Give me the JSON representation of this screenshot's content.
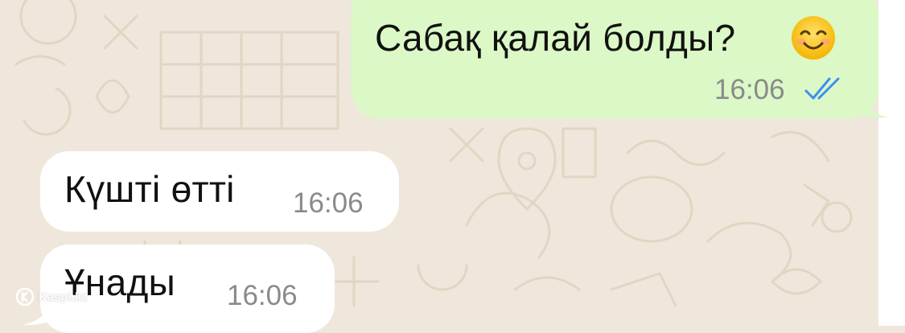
{
  "messages": [
    {
      "direction": "outgoing",
      "text": "Сабақ қалай болды?",
      "emoji": "smiling-face-emoji",
      "time": "16:06",
      "status": "read"
    },
    {
      "direction": "incoming",
      "text": "Күшті өтті",
      "time": "16:06"
    },
    {
      "direction": "incoming",
      "text": "Ұнады",
      "time": "16:06"
    }
  ],
  "watermark": {
    "label": "Kaspi.kz"
  },
  "colors": {
    "background": "#efe7dc",
    "outgoing_bubble": "#dbf8c6",
    "incoming_bubble": "#ffffff",
    "read_ticks": "#3a8ff0",
    "timestamp": "#8a8a8a"
  }
}
